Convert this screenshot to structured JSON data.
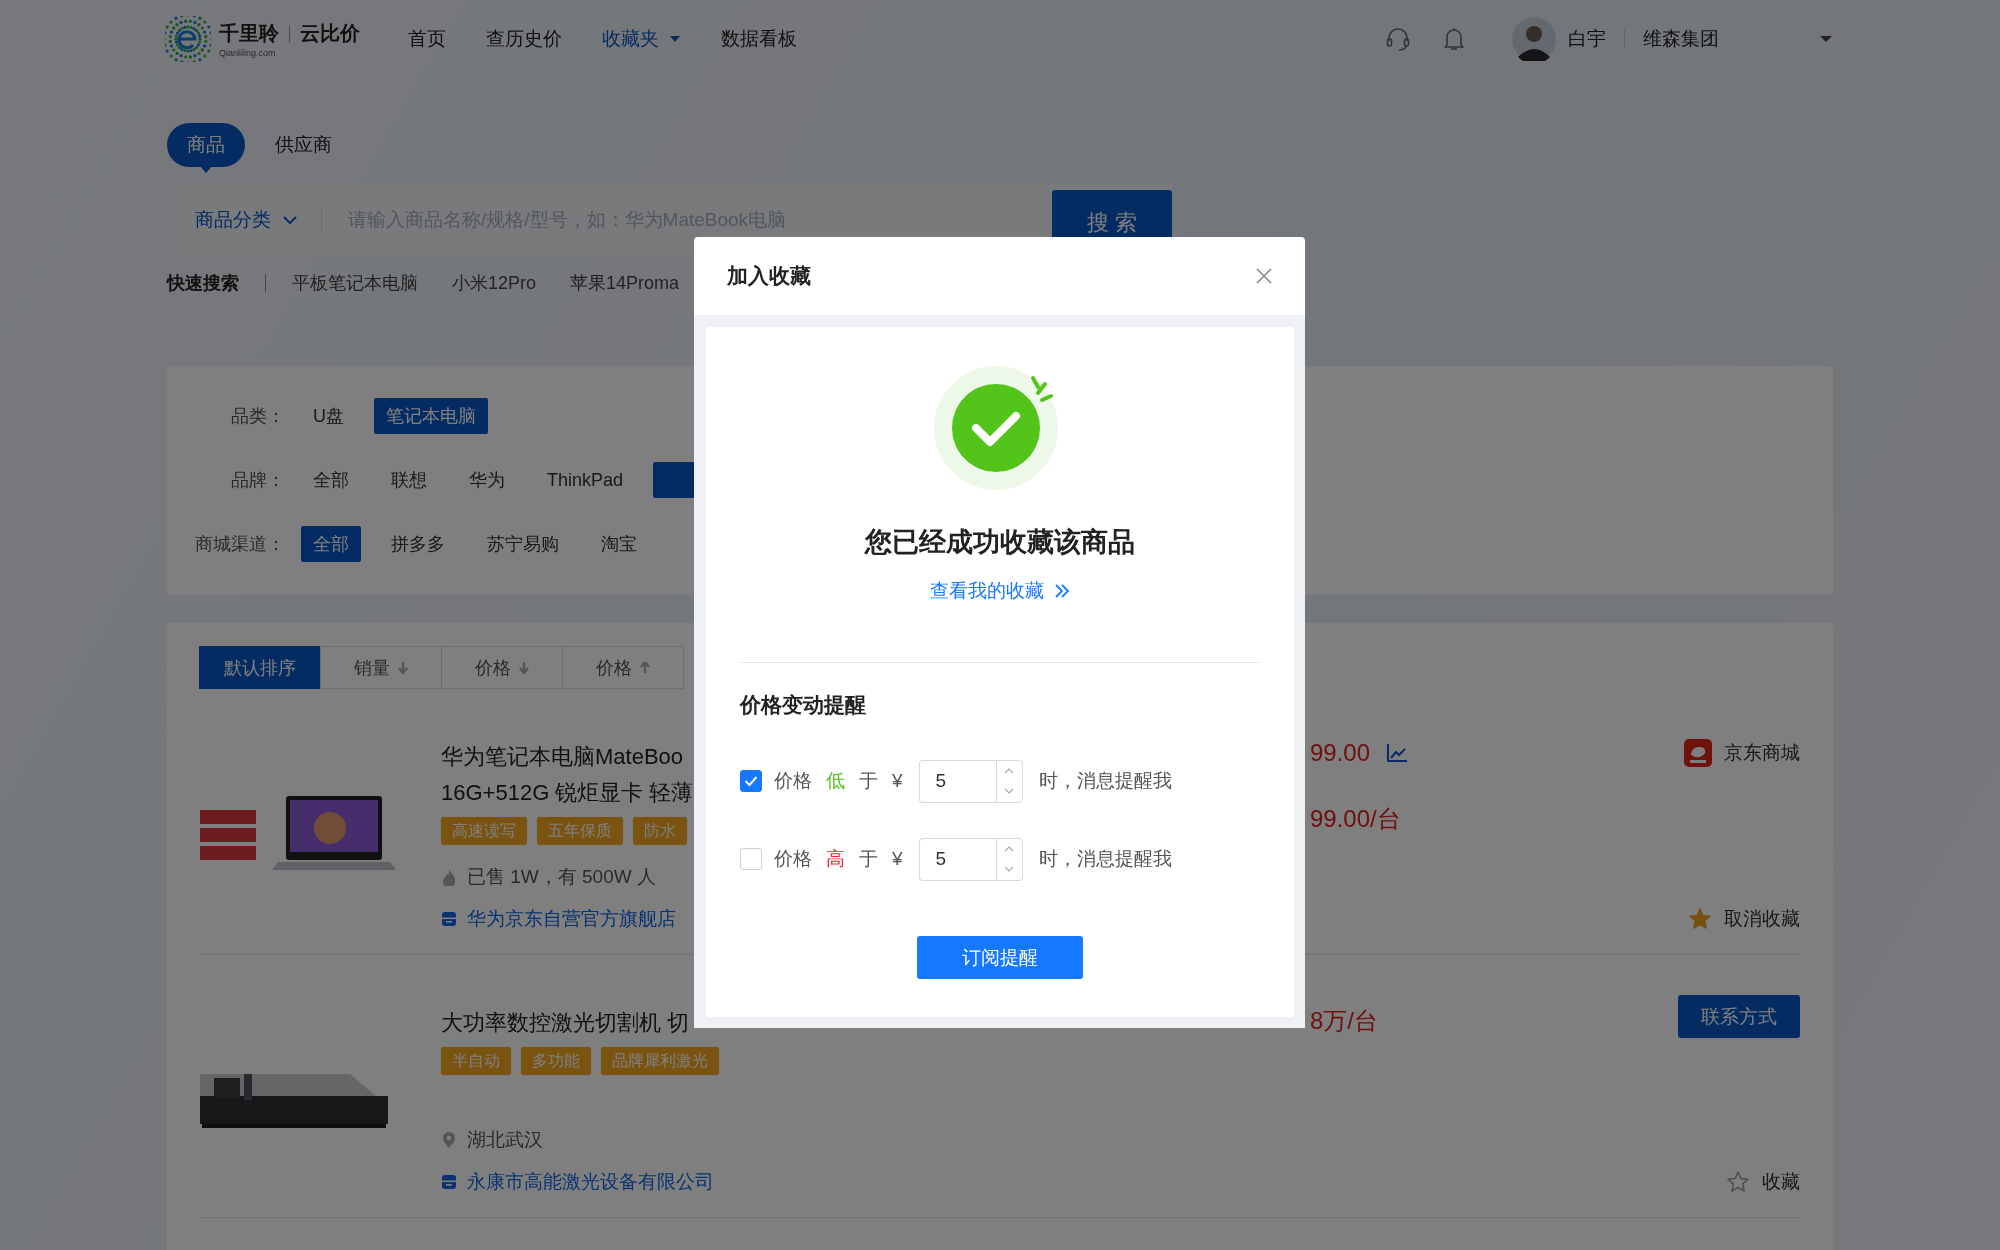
{
  "header": {
    "logo": {
      "brand": "千里聆",
      "product": "云比价",
      "domain": "Qianliling.com"
    },
    "nav": [
      {
        "label": "首页",
        "selected": false,
        "dropdown": false
      },
      {
        "label": "查历史价",
        "selected": false,
        "dropdown": false
      },
      {
        "label": "收藏夹",
        "selected": true,
        "dropdown": true
      },
      {
        "label": "数据看板",
        "selected": false,
        "dropdown": false
      }
    ],
    "user": {
      "name": "白宇",
      "company": "维森集团"
    }
  },
  "search_tabs": [
    {
      "label": "商品",
      "selected": true
    },
    {
      "label": "供应商",
      "selected": false
    }
  ],
  "search": {
    "category": "商品分类",
    "placeholder": "请输入商品名称/规格/型号，如：华为MateBook电脑",
    "button": "搜 索"
  },
  "quick_search": {
    "label": "快速搜索",
    "items": [
      "平板笔记本电脑",
      "小米12Pro",
      "苹果14Proma"
    ]
  },
  "filters": [
    {
      "label": "品类：",
      "options": [
        {
          "label": "U盘",
          "selected": false
        },
        {
          "label": "笔记本电脑",
          "selected": true
        }
      ]
    },
    {
      "label": "品牌：",
      "options": [
        {
          "label": "全部",
          "selected": false
        },
        {
          "label": "联想",
          "selected": false
        },
        {
          "label": "华为",
          "selected": false
        },
        {
          "label": "ThinkPad",
          "selected": false
        },
        {
          "selected": true
        }
      ]
    },
    {
      "label": "商城渠道：",
      "options": [
        {
          "label": "全部",
          "selected": true
        },
        {
          "label": "拼多多",
          "selected": false
        },
        {
          "label": "苏宁易购",
          "selected": false
        },
        {
          "label": "淘宝",
          "selected": false
        }
      ]
    }
  ],
  "sort_options": [
    {
      "label": "默认排序",
      "kind": "plain",
      "selected": true
    },
    {
      "label": "销量",
      "kind": "descending",
      "selected": false
    },
    {
      "label": "价格",
      "kind": "descending",
      "selected": false
    },
    {
      "label": "价格",
      "kind": "ascending",
      "selected": false
    }
  ],
  "products": [
    {
      "title_lines": [
        "华为笔记本电脑MateBoo",
        "16G+512G 锐炬显卡 轻薄"
      ],
      "tags": [
        "高速读写",
        "五年保质",
        "防水"
      ],
      "prices": [
        {
          "text": "99.00",
          "trend": true
        },
        {
          "text": "99.00/台",
          "trend": false
        }
      ],
      "meta": [
        {
          "kind": "sales",
          "text": "已售 1W，有 500W 人"
        },
        {
          "kind": "store",
          "text": "华为京东自营官方旗舰店"
        }
      ],
      "source": {
        "kind": "mall",
        "label": "京东商城"
      },
      "favorite": {
        "on": true,
        "label": "取消收藏"
      }
    },
    {
      "title_lines": [
        "大功率数控激光切割机 切"
      ],
      "tags": [
        "半自动",
        "多功能",
        "品牌犀利激光"
      ],
      "prices": [
        {
          "text": "8万/台",
          "trend": false
        }
      ],
      "meta": [
        {
          "kind": "location",
          "text": "湖北武汉"
        },
        {
          "kind": "store",
          "text": "永康市高能激光设备有限公司"
        }
      ],
      "source": {
        "kind": "contact",
        "label": "联系方式"
      },
      "favorite": {
        "on": false,
        "label": "收藏"
      }
    }
  ],
  "modal": {
    "title": "加入收藏",
    "message": "您已经成功收藏该商品",
    "link": "查看我的收藏",
    "section_title": "价格变动提醒",
    "alerts": [
      {
        "checked": true,
        "label": "价格",
        "direction": "低",
        "kind": "low",
        "connector": "于",
        "currency": "¥",
        "value": "5",
        "suffix": "时，消息提醒我"
      },
      {
        "checked": false,
        "label": "价格",
        "direction": "高",
        "kind": "high",
        "connector": "于",
        "currency": "¥",
        "value": "5",
        "suffix": "时，消息提醒我"
      }
    ],
    "button": "订阅提醒"
  }
}
